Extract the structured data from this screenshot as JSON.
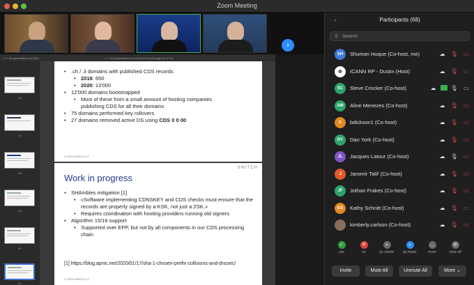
{
  "window": {
    "title": "Zoom Meeting"
  },
  "video_strip": {
    "tiles": [
      {
        "name": ""
      },
      {
        "name": ""
      },
      {
        "name": ""
      },
      {
        "name": ""
      }
    ],
    "next_icon": "chevron-right-icon"
  },
  "document": {
    "tab_title": "1 / 7 Al presentations-ai 2020-09-16.pdf (page 51 of 57)",
    "sidebar_title": "1 / 7 Al presentations ai 2020...",
    "thumb_numbers": [
      "46",
      "47",
      "48",
      "49",
      "50",
      "51"
    ],
    "page1": {
      "bullets": [
        {
          "level": 0,
          "text": ".ch / .li domains with published CDS records"
        },
        {
          "level": 1,
          "bold": "2018",
          "text": ": 650"
        },
        {
          "level": 1,
          "bold": "2020",
          "text": ": 13'000"
        },
        {
          "level": 0,
          "text": "12'000 domains bootstrapped"
        },
        {
          "level": 1,
          "text": "Most of these from a small amount of hosting companies publishing CDS for all their domains"
        },
        {
          "level": 0,
          "text": "75 domains performed key rollovers"
        },
        {
          "level": 0,
          "text": "27 domains removed active DS using ",
          "bold_tail": "CDS 0 0 00"
        }
      ],
      "footer": "© 2020 SWITCH | 3"
    },
    "page2": {
      "logo": "SWITCH",
      "title": "Work in progress",
      "bullets": [
        {
          "level": 0,
          "text": "SHAmbles mitigation [1]"
        },
        {
          "level": 1,
          "text": "«Software implementing CDNSKEY and CDS checks must ensure that the records are properly signed by a KSK, not just a ZSK.»"
        },
        {
          "level": 1,
          "text": "Requires coordination with hosting providers running old signers"
        },
        {
          "level": 0,
          "text": "Algorithm 15/16 support"
        },
        {
          "level": 1,
          "text": "Supported over EPP, but not by all components in our CDS processing chain"
        }
      ],
      "reference": "[1] https://blog.apnic.net/2020/01/17/sha-1-chosen-prefix-collisions-and-dnssec/",
      "footer": "© 2020 SWITCH | 4"
    }
  },
  "participants": {
    "title": "Participants (68)",
    "search_placeholder": "Search",
    "list": [
      {
        "initials": "SH",
        "color": "#3b7bd4",
        "name": "Shumon Huque (Co-host, me)",
        "mic": "muted",
        "video": "off",
        "share": false
      },
      {
        "initials": "",
        "color": "#ffffff",
        "name": "ICANN RP - Dustin (Host)",
        "mic": "muted",
        "video": "off",
        "share": false
      },
      {
        "initials": "SC",
        "color": "#2da36b",
        "name": "Steve Crocker (Co-host)",
        "mic": "on",
        "video": "on",
        "share": true
      },
      {
        "initials": "AM",
        "color": "#2da36b",
        "name": "Aline Menezes (Co-host)",
        "mic": "muted",
        "video": "off",
        "share": false
      },
      {
        "initials": "b",
        "color": "#e08a1f",
        "name": "bdickson1 (Co-host)",
        "mic": "muted",
        "video": "off",
        "share": false
      },
      {
        "initials": "DY",
        "color": "#2da36b",
        "name": "Dan York (Co-host)",
        "mic": "muted",
        "video": "off",
        "share": false
      },
      {
        "initials": "JL",
        "color": "#7e57c2",
        "name": "Jacques Latour (Co-host)",
        "mic": "on",
        "video": "off",
        "share": false
      },
      {
        "initials": "J",
        "color": "#e05a2b",
        "name": "Jaromír Talíř (Co-host)",
        "mic": "muted",
        "video": "off",
        "share": false
      },
      {
        "initials": "JF",
        "color": "#2da36b",
        "name": "Jothan Frakes (Co-host)",
        "mic": "muted",
        "video": "off",
        "share": false
      },
      {
        "initials": "KS",
        "color": "#e08a1f",
        "name": "Kathy Schnitt (Co-host)",
        "mic": "muted",
        "video": "off",
        "share": false
      },
      {
        "initials": "",
        "color": "#8a6d5a",
        "name": "kimberly.carlson (Co-host)",
        "mic": "muted",
        "video": "off",
        "share": false
      }
    ],
    "reactions": [
      {
        "label": "yes",
        "symbol": "✓",
        "color": "#2e9e3e"
      },
      {
        "label": "no",
        "symbol": "✕",
        "color": "#d8453a"
      },
      {
        "label": "go slower",
        "symbol": "«",
        "color": "#6a6a6a"
      },
      {
        "label": "go faster",
        "symbol": "»",
        "color": "#2d8cff"
      },
      {
        "label": "more",
        "symbol": "…",
        "color": "#6a6a6a"
      },
      {
        "label": "clear all",
        "symbol": "⊘",
        "color": "#6a6a6a"
      }
    ],
    "buttons": {
      "invite": "Invite",
      "mute_all": "Mute All",
      "unmute_all": "Unmute All",
      "more": "More ⌄"
    }
  },
  "icons": {
    "mic_muted": "🎤̸",
    "video_off": "▭"
  }
}
